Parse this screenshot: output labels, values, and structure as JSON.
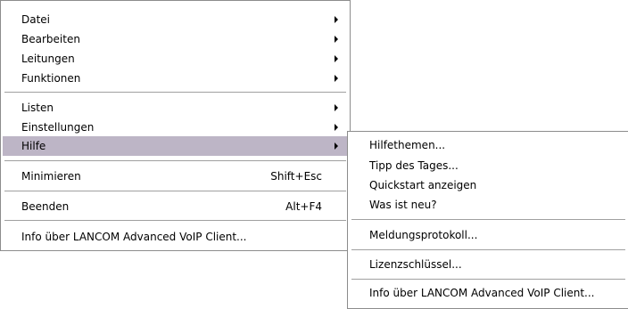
{
  "main_menu": {
    "items": [
      {
        "label": "Datei",
        "submenu": true
      },
      {
        "label": "Bearbeiten",
        "submenu": true
      },
      {
        "label": "Leitungen",
        "submenu": true
      },
      {
        "label": "Funktionen",
        "submenu": true
      },
      {
        "label": "Listen",
        "submenu": true
      },
      {
        "label": "Einstellungen",
        "submenu": true
      },
      {
        "label": "Hilfe",
        "submenu": true,
        "highlighted": true
      },
      {
        "label": "Minimieren",
        "shortcut": "Shift+Esc"
      },
      {
        "label": "Beenden",
        "shortcut": "Alt+F4"
      },
      {
        "label": "Info über LANCOM Advanced VoIP Client..."
      }
    ]
  },
  "help_submenu": {
    "items": [
      {
        "label": "Hilfethemen..."
      },
      {
        "label": "Tipp des Tages..."
      },
      {
        "label": "Quickstart anzeigen"
      },
      {
        "label": "Was ist neu?"
      },
      {
        "label": "Meldungsprotokoll..."
      },
      {
        "label": "Lizenzschlüssel..."
      },
      {
        "label": "Info über LANCOM Advanced VoIP Client..."
      }
    ]
  },
  "colors": {
    "highlight": "#bdb5c6",
    "border": "#8c8c8c",
    "separator": "#a0a0a0"
  }
}
